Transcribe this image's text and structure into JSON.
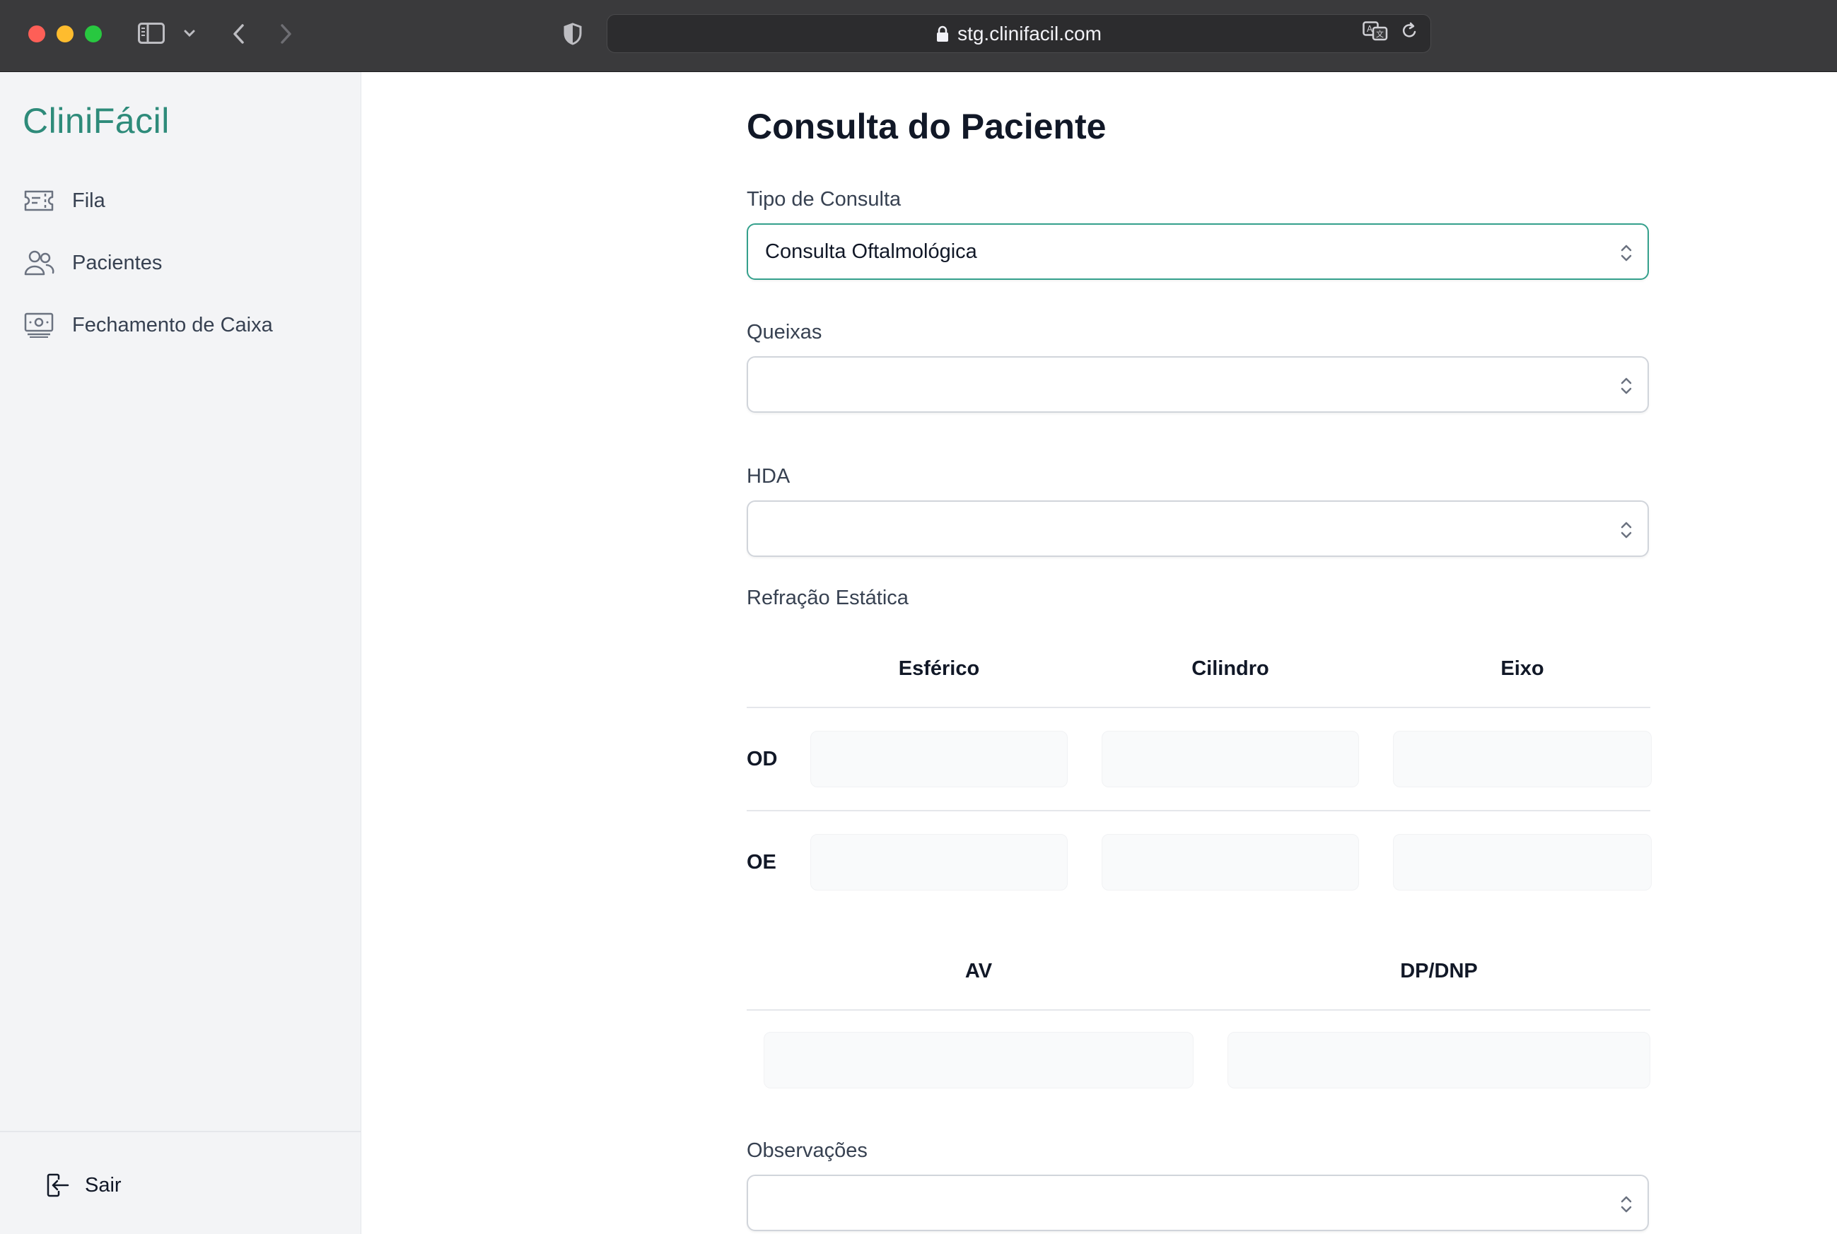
{
  "browser": {
    "url": "stg.clinifacil.com"
  },
  "sidebar": {
    "logo": "CliniFácil",
    "items": [
      {
        "label": "Fila",
        "icon": "ticket-icon"
      },
      {
        "label": "Pacientes",
        "icon": "users-icon"
      },
      {
        "label": "Fechamento de Caixa",
        "icon": "cash-icon"
      }
    ],
    "logout_label": "Sair"
  },
  "main": {
    "title": "Consulta do Paciente",
    "tipo_consulta": {
      "label": "Tipo de Consulta",
      "value": "Consulta Oftalmológica"
    },
    "queixas": {
      "label": "Queixas",
      "value": ""
    },
    "hda": {
      "label": "HDA",
      "value": ""
    },
    "refracao": {
      "label": "Refração Estática",
      "columns": [
        "Esférico",
        "Cilindro",
        "Eixo"
      ],
      "rows": [
        "OD",
        "OE"
      ]
    },
    "av_dp": {
      "columns": [
        "AV",
        "DP/DNP"
      ]
    },
    "observacoes": {
      "label": "Observações",
      "value": ""
    }
  },
  "colors": {
    "brand": "#2e8b7a",
    "active_border": "#34a08c"
  }
}
